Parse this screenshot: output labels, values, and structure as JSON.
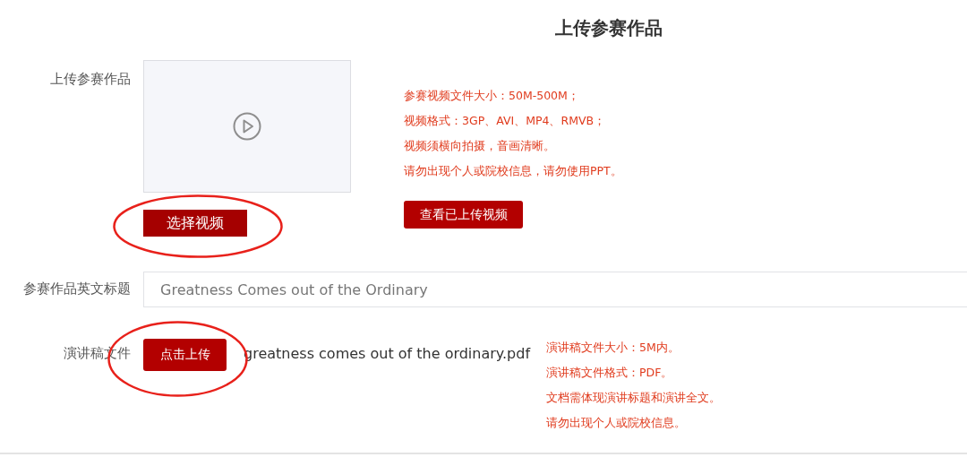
{
  "title": "上传参赛作品",
  "video": {
    "label": "上传参赛作品",
    "select_button": "选择视频",
    "select_circled": true,
    "notes": [
      "参赛视频文件大小：50M-500M；",
      "视频格式：3GP、AVI、MP4、RMVB；",
      "视频须横向拍摄，音画清晰。",
      "请勿出现个人或院校信息，请勿使用PPT。"
    ],
    "view_button": "查看已上传视频"
  },
  "english_title": {
    "label": "参赛作品英文标题",
    "value": "Greatness Comes out of the Ordinary"
  },
  "speech": {
    "label": "演讲稿文件",
    "upload_button": "点击上传",
    "upload_circled": true,
    "file_name": "greatness comes out of the ordinary.pdf",
    "notes": [
      "演讲稿文件大小：5M内。",
      "演讲稿文件格式：PDF。",
      "文档需体现演讲标题和演讲全文。",
      "请勿出现个人或院校信息。"
    ]
  }
}
